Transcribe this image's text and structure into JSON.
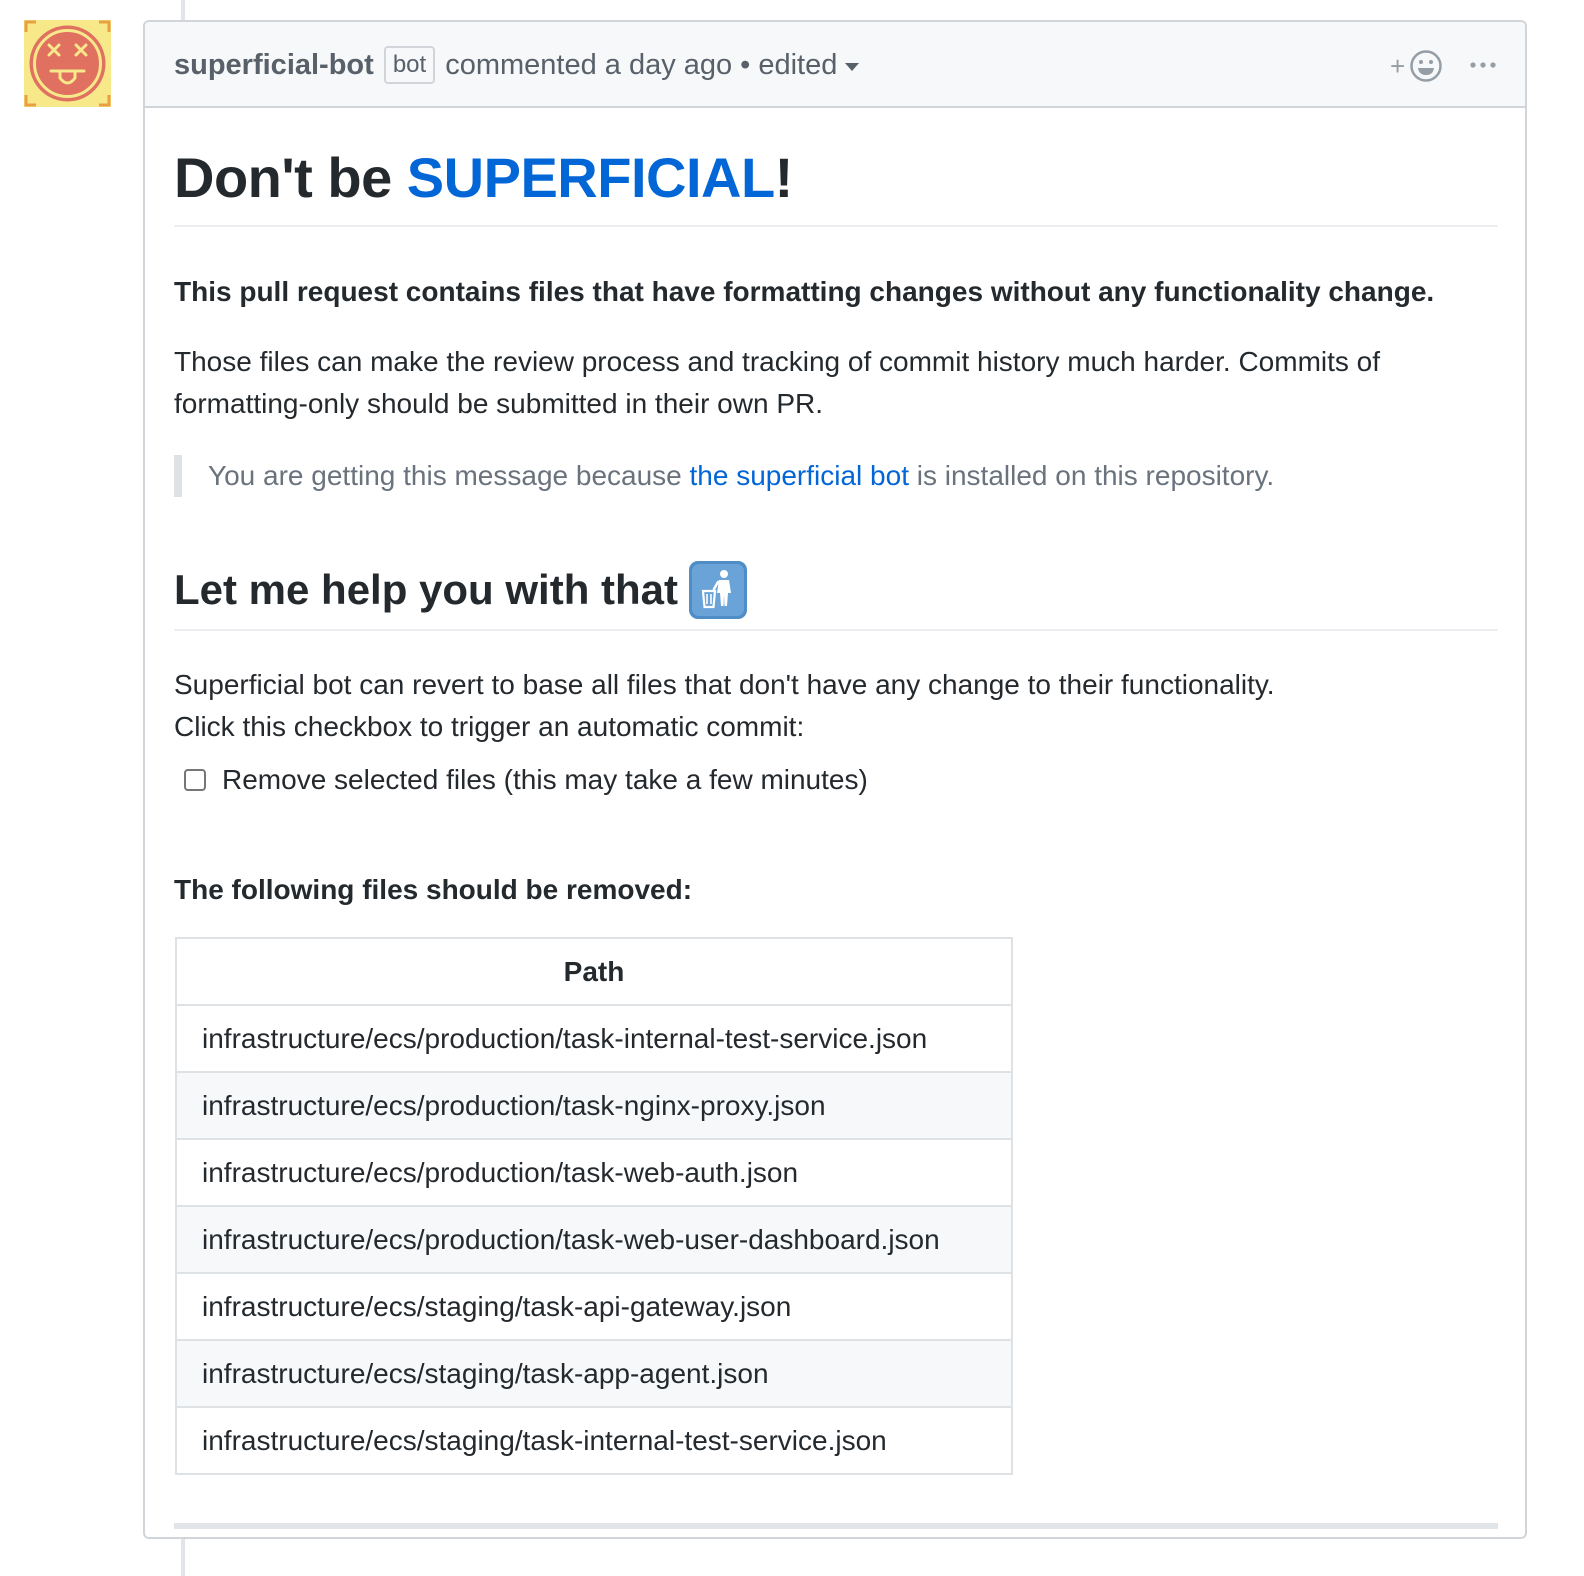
{
  "comment": {
    "author": "superficial-bot",
    "bot_label": "bot",
    "action_text": "commented a day ago",
    "separator": "•",
    "edited_label": "edited",
    "reaction_label": "+"
  },
  "body": {
    "title_prefix": "Don't be ",
    "title_link": "SUPERFICIAL",
    "title_suffix": "!",
    "intro_bold": "This pull request contains files that have formatting changes without any functionality change.",
    "intro_text": "Those files can make the review process and tracking of commit history much harder. Commits of formatting-only should be submitted in their own PR.",
    "quote_prefix": "You are getting this message because ",
    "quote_link": "the superficial bot",
    "quote_suffix": " is installed on this repository.",
    "help_heading": "Let me help you with that",
    "help_line1": "Superficial bot can revert to base all files that don't have any change to their functionality.",
    "help_line2": "Click this checkbox to trigger an automatic commit:",
    "task_label": "Remove selected files (this may take a few minutes)",
    "files_heading": "The following files should be removed:",
    "table_header": "Path",
    "files": [
      "infrastructure/ecs/production/task-internal-test-service.json",
      "infrastructure/ecs/production/task-nginx-proxy.json",
      "infrastructure/ecs/production/task-web-auth.json",
      "infrastructure/ecs/production/task-web-user-dashboard.json",
      "infrastructure/ecs/staging/task-api-gateway.json",
      "infrastructure/ecs/staging/task-app-agent.json",
      "infrastructure/ecs/staging/task-internal-test-service.json"
    ]
  },
  "colors": {
    "link": "#0366d6",
    "avatar_face": "#e07060",
    "avatar_bg": "#f7e88a"
  },
  "icons": {
    "avatar": "dizzy-face-avatar",
    "emoji": "put-litter-in-its-place-emoji",
    "reaction": "smiley-icon",
    "more": "kebab-horizontal-icon"
  }
}
